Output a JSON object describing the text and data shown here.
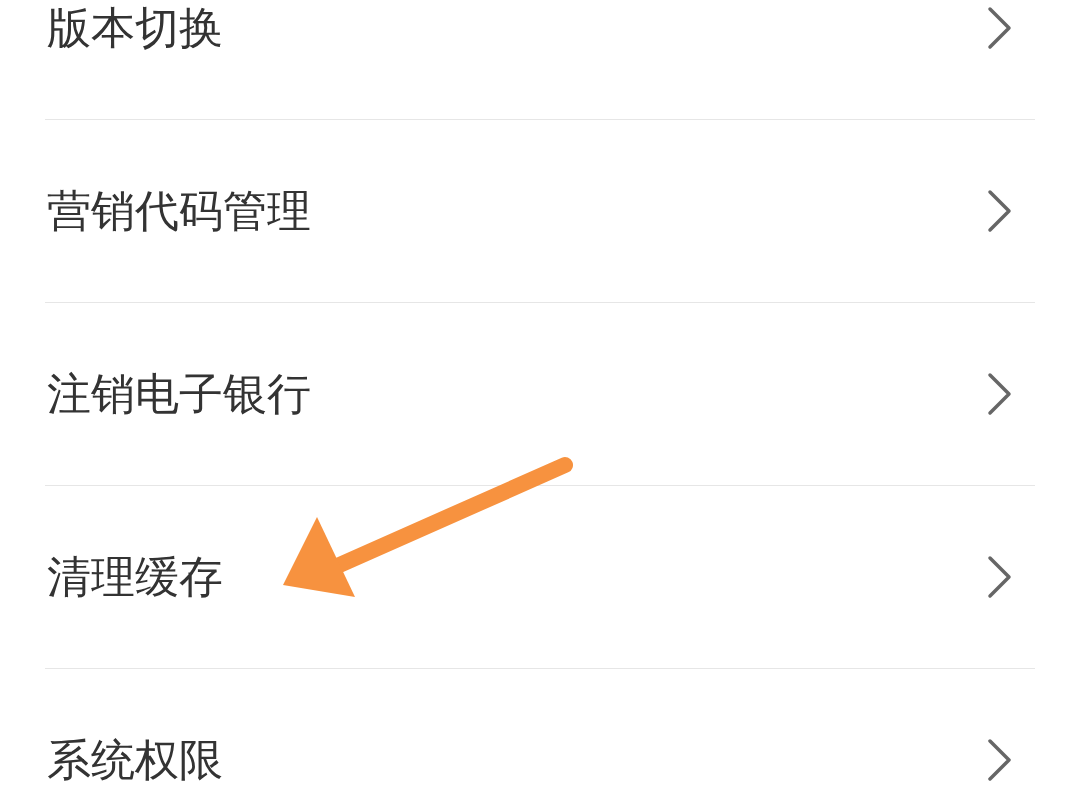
{
  "settings_list": {
    "items": [
      {
        "label": "版本切换",
        "pointed": false
      },
      {
        "label": "营销代码管理",
        "pointed": false
      },
      {
        "label": "注销电子银行",
        "pointed": false
      },
      {
        "label": "清理缓存",
        "pointed": true
      },
      {
        "label": "系统权限",
        "pointed": false
      }
    ]
  }
}
